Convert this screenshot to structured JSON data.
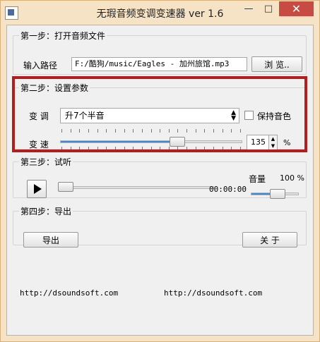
{
  "window": {
    "title": "无瑕音频变调变速器 ver 1.6",
    "controls": {
      "minimize": "—",
      "maximize": "□",
      "close": "✕"
    }
  },
  "step1": {
    "legend": "第一步：打开音频文件",
    "input_label": "输入路径",
    "path_value": "F:/酷狗/music/Eagles - 加州旅馆.mp3",
    "browse_button": "浏 览.."
  },
  "step2": {
    "legend": "第二步：设置参数",
    "pitch_label": "变 调",
    "pitch_selected": "升7个半音",
    "keep_timbre_label": "保持音色",
    "keep_timbre_checked": false,
    "speed_label": "变 速",
    "speed_value": "135",
    "speed_unit": "%",
    "speed_slider_fraction": 0.66
  },
  "step3": {
    "legend": "第三步：试听",
    "time": "00:00:00",
    "volume_label": "音量",
    "volume_value": "100 %",
    "progress_fraction": 0.0,
    "volume_fraction": 0.6
  },
  "step4": {
    "legend": "第四步：导出",
    "export_button": "导出",
    "close_button": "关 于"
  },
  "footer": {
    "url_left": "http://dsoundsoft.com",
    "url_right": "http://dsoundsoft.com"
  }
}
